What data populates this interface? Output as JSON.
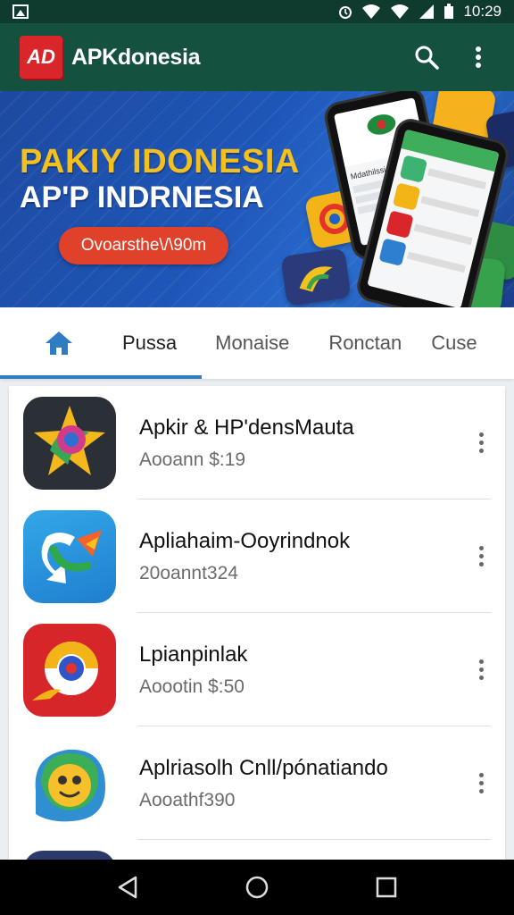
{
  "status_bar": {
    "time": "10:29"
  },
  "app_bar": {
    "logo_text": "AD",
    "title": "APKdonesia"
  },
  "banner": {
    "line1": "PAKIY IDONESIA",
    "line2": "AP'P INDRNESIA",
    "button_label": "Ovoarsthe\\/\\90m",
    "phone_screen_title": "Mdathilssia"
  },
  "tabs": [
    {
      "label": "Pussa"
    },
    {
      "label": "Monaise"
    },
    {
      "label": "Ronctan"
    },
    {
      "label": "Cuse"
    }
  ],
  "apps": [
    {
      "name": "Apkir & HP'densMauta",
      "sub": "Aooann $:19",
      "icon": "star-film-icon"
    },
    {
      "name": "Apliahaim-Ooyrindnok",
      "sub": "20oannt324",
      "icon": "chat-arrow-icon"
    },
    {
      "name": "Lpianpinlak",
      "sub": "Aoootin $:50",
      "icon": "circle-swirl-icon"
    },
    {
      "name": "Aplriasolh Cnll/pónatiando",
      "sub": "Aooathf390",
      "icon": "smiley-icon"
    }
  ],
  "colors": {
    "status_bar": "#0f3b2e",
    "app_bar": "#15513f",
    "accent_tab": "#2e7cc1",
    "banner_button": "#e0412b",
    "logo": "#d8262a"
  }
}
